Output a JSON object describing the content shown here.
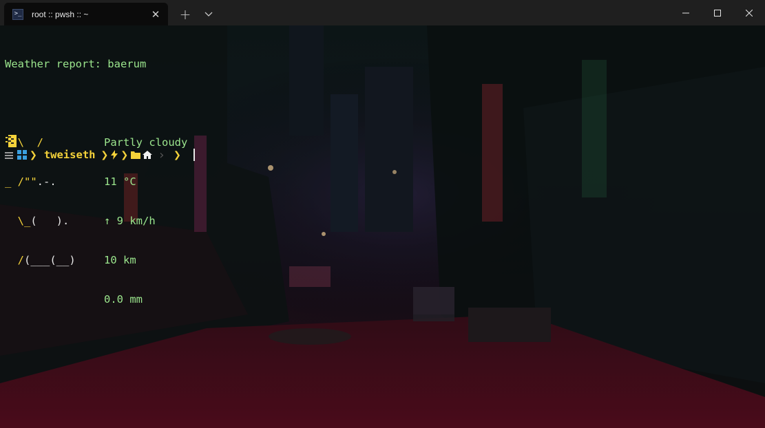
{
  "window": {
    "tab_title": "root :: pwsh :: ~",
    "tab_icon": "powershell-icon",
    "new_tab_symbol": "+",
    "dropdown_symbol": "⌵",
    "close_tab_symbol": "✕"
  },
  "terminal": {
    "weather_header": "Weather report: baerum",
    "art": [
      "  \\  /",
      "_ /\"\".-.",
      "  \\_(   ).",
      "  /(___(__)"
    ],
    "conditions": [
      "Partly cloudy",
      "11 °C",
      "↑ 9 km/h",
      "10 km",
      "0.0 mm"
    ],
    "prompt": {
      "username": "tweiseth",
      "separator": "❯",
      "prompt_char": "❯",
      "icons": [
        "windows-icon",
        "lightning-icon",
        "folder-icon",
        "home-icon"
      ]
    }
  },
  "colors": {
    "weather_text": "#9be58d",
    "prompt_accent": "#f4d23a",
    "titlebar": "#1f1f1f",
    "tab": "#0b0b0b"
  }
}
